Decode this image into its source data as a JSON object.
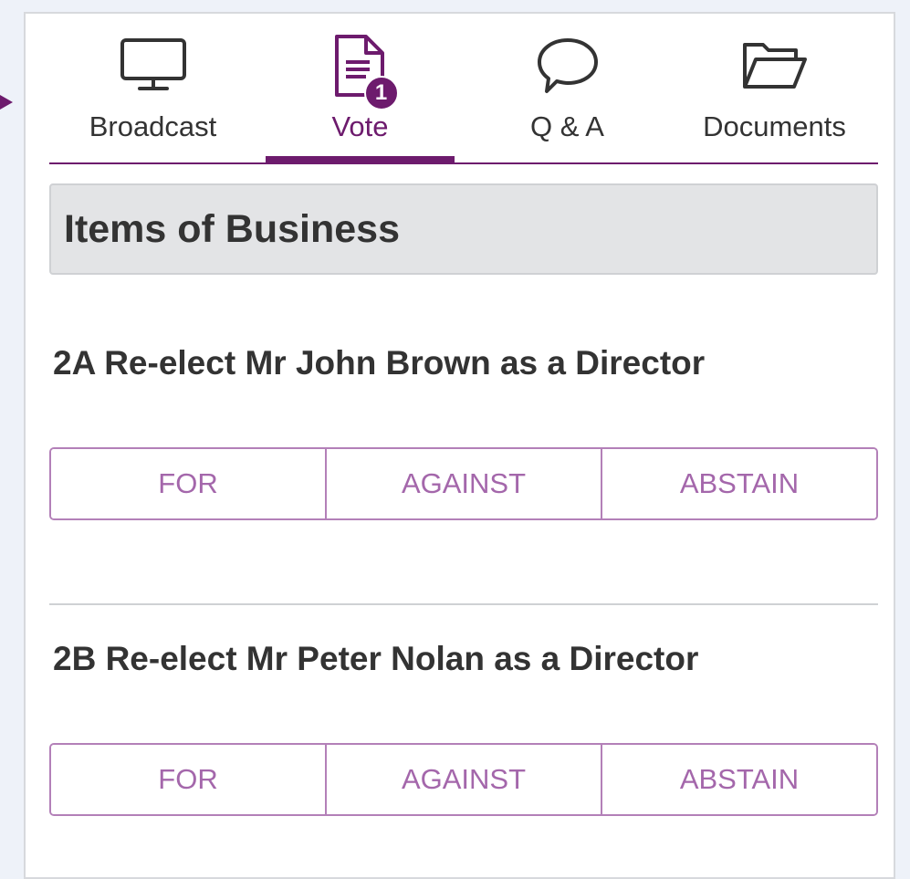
{
  "tabs": [
    {
      "label": "Broadcast",
      "icon": "monitor-icon",
      "active": false
    },
    {
      "label": "Vote",
      "icon": "document-icon",
      "active": true,
      "badge": "1"
    },
    {
      "label": "Q & A",
      "icon": "speech-bubble-icon",
      "active": false
    },
    {
      "label": "Documents",
      "icon": "folder-icon",
      "active": false
    }
  ],
  "section": {
    "title": "Items of Business"
  },
  "items": [
    {
      "title": "2A Re-elect Mr John Brown as a Director",
      "options": [
        "FOR",
        "AGAINST",
        "ABSTAIN"
      ]
    },
    {
      "title": "2B Re-elect Mr Peter Nolan as a Director",
      "options": [
        "FOR",
        "AGAINST",
        "ABSTAIN"
      ]
    }
  ],
  "colors": {
    "accent": "#6d1b6d",
    "button_text": "#a467ab",
    "button_border": "#b380b8",
    "header_bg": "#e3e4e6"
  }
}
